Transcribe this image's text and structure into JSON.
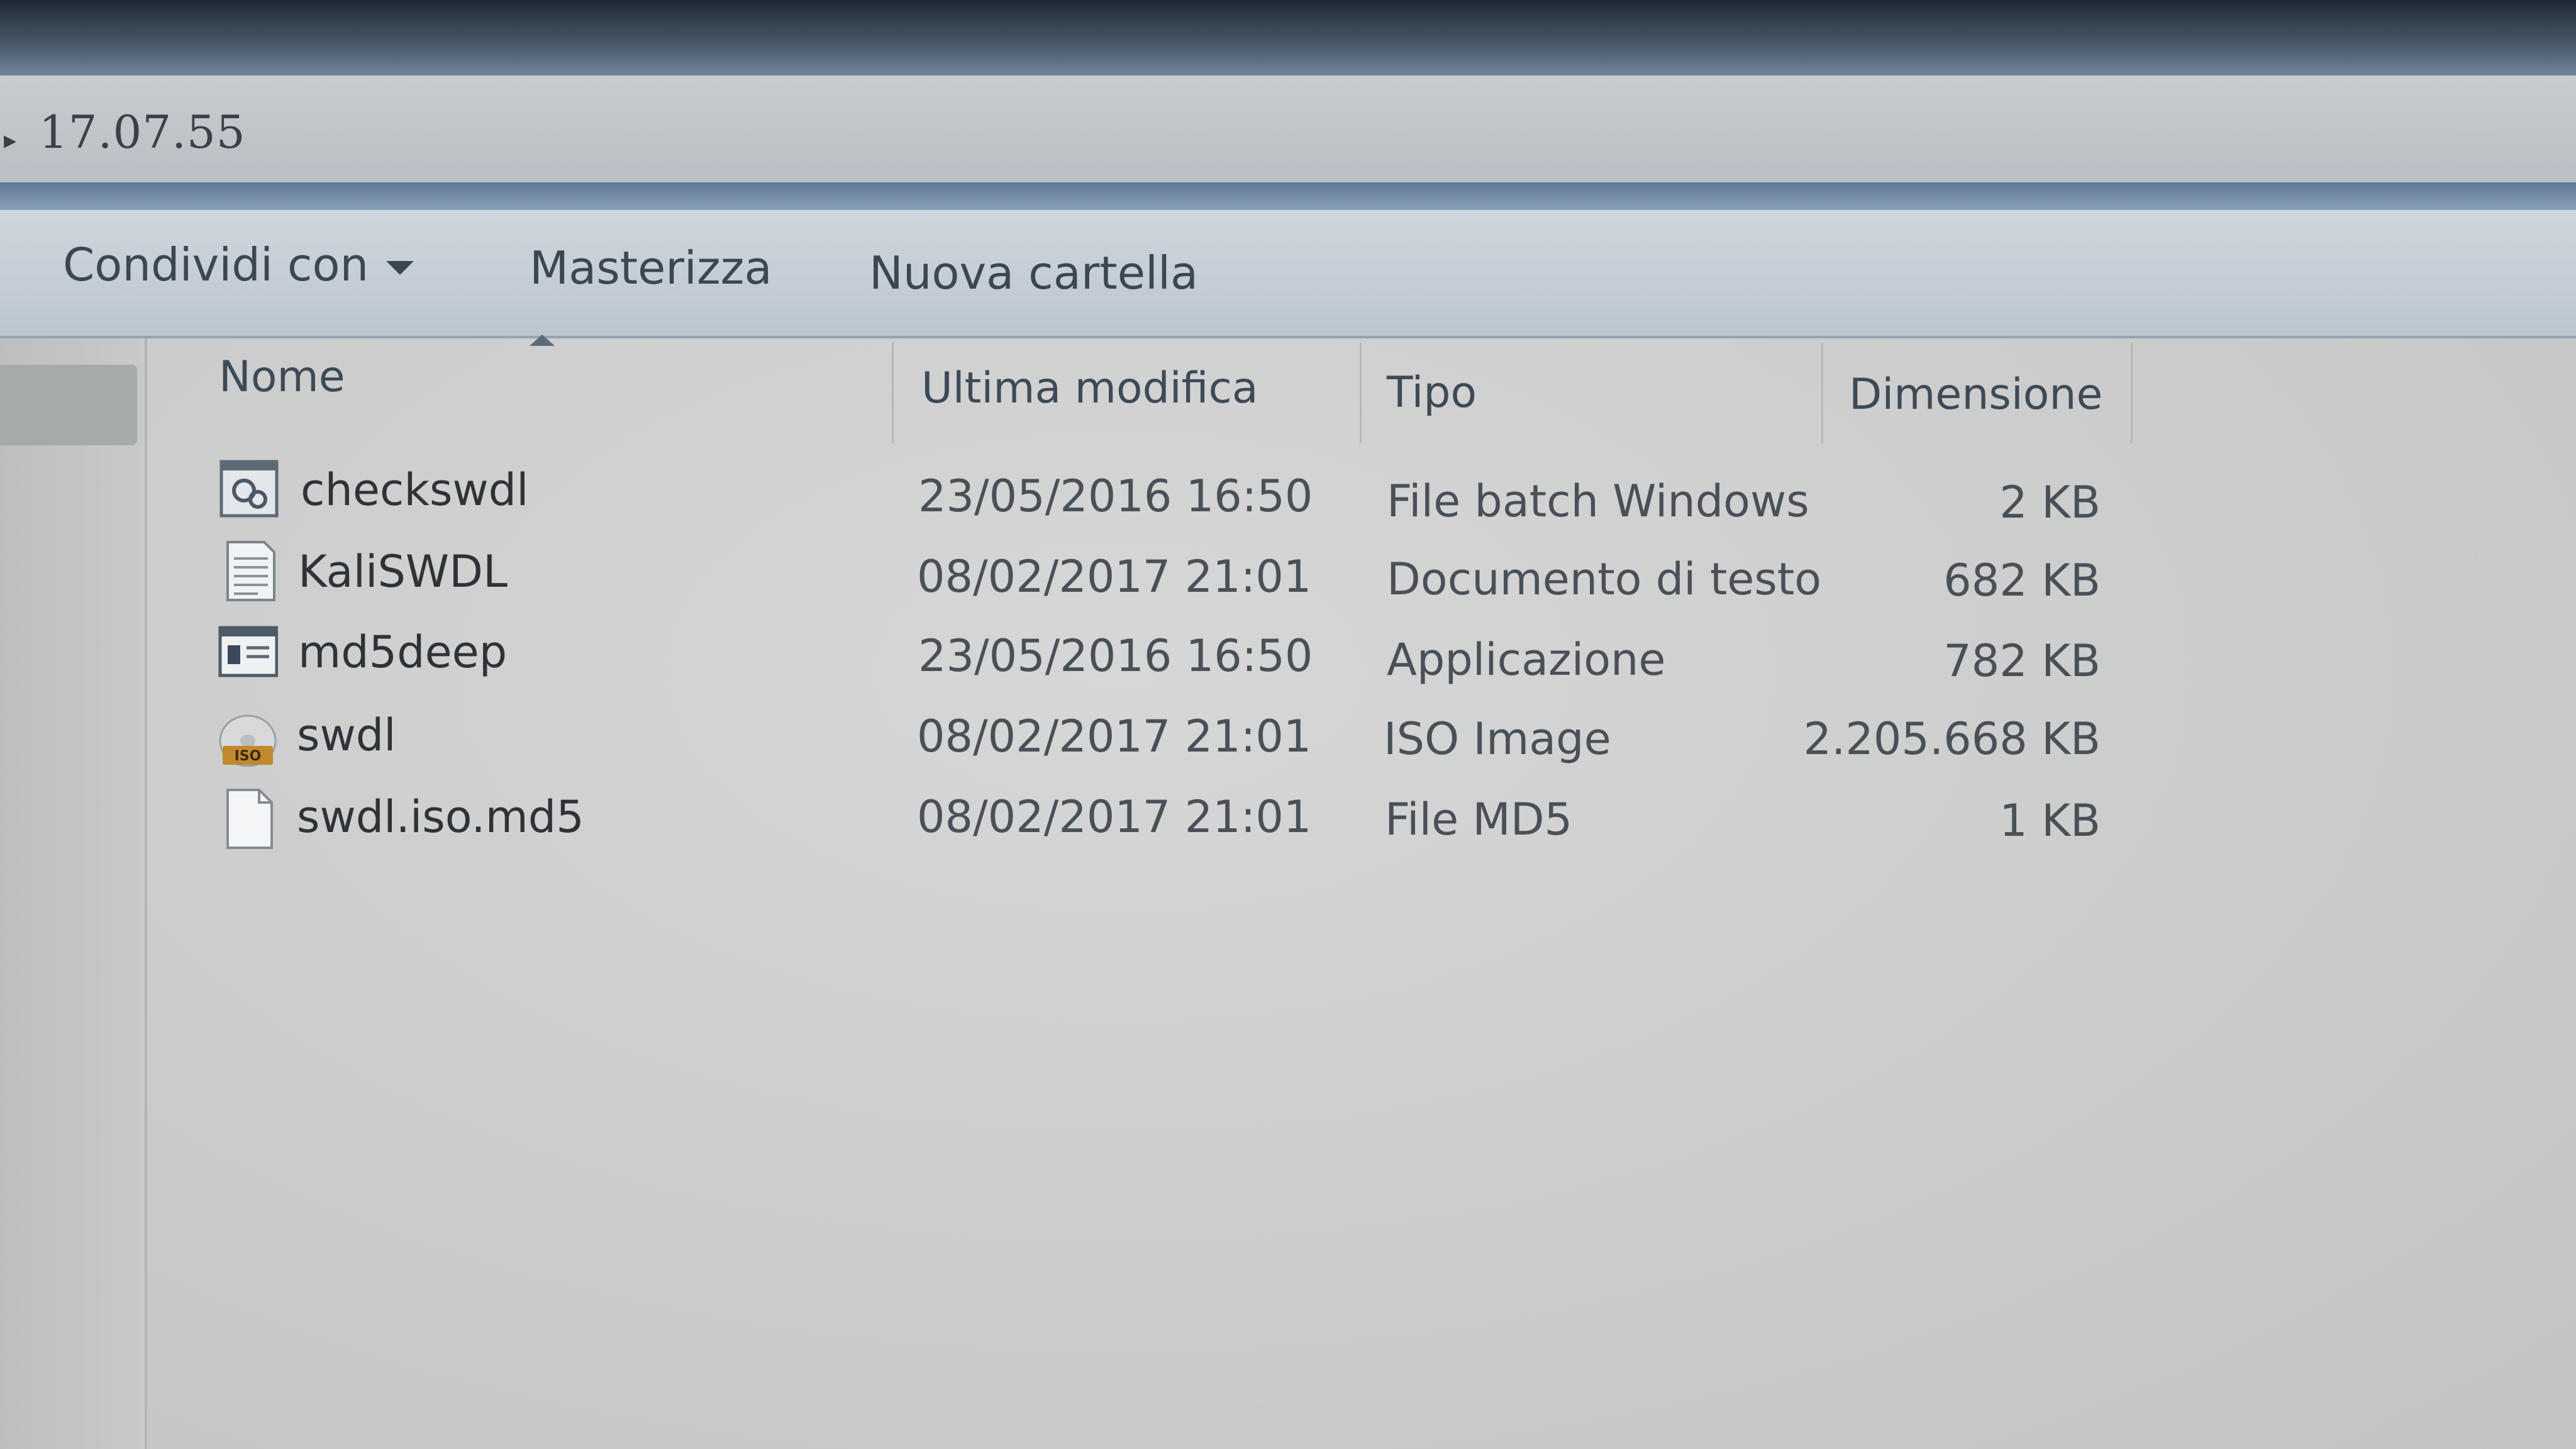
{
  "address_bar": {
    "path_tail": "17.07.55"
  },
  "toolbar": {
    "share_label": "Condividi con",
    "burn_label": "Masterizza",
    "new_folder_label": "Nuova cartella"
  },
  "columns": {
    "name": "Nome",
    "modified": "Ultima modifica",
    "type": "Tipo",
    "size": "Dimensione"
  },
  "files": [
    {
      "name": "checkswdl",
      "modified": "23/05/2016 16:50",
      "type": "File batch Windows",
      "size": "2 KB",
      "icon": "batch-file-icon"
    },
    {
      "name": "KaliSWDL",
      "modified": "08/02/2017 21:01",
      "type": "Documento di testo",
      "size": "682 KB",
      "icon": "text-document-icon"
    },
    {
      "name": "md5deep",
      "modified": "23/05/2016 16:50",
      "type": "Applicazione",
      "size": "782 KB",
      "icon": "application-icon"
    },
    {
      "name": "swdl",
      "modified": "08/02/2017 21:01",
      "type": "ISO Image",
      "size": "2.205.668 KB",
      "icon": "iso-disc-icon"
    },
    {
      "name": "swdl.iso.md5",
      "modified": "08/02/2017 21:01",
      "type": "File MD5",
      "size": "1 KB",
      "icon": "blank-file-icon"
    }
  ],
  "colors": {
    "header_text": "#3d4a57",
    "row_text": "#2f3337",
    "toolbar_bg": "#c6cfd7",
    "accent_strip": "#6d87a2"
  }
}
